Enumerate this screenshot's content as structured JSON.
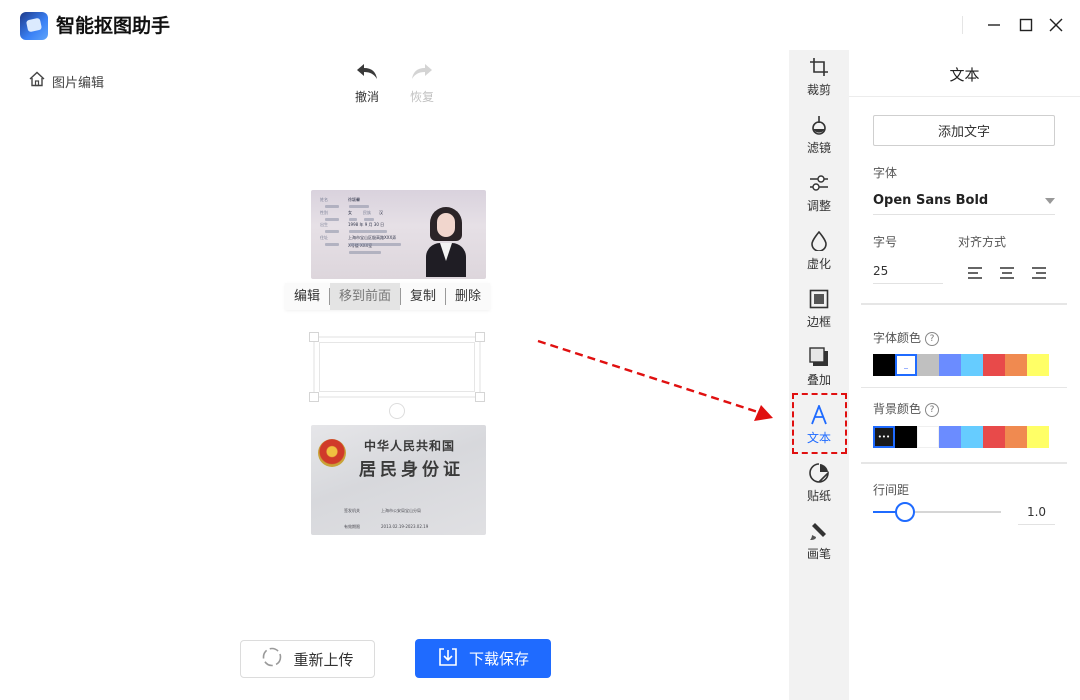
{
  "app": {
    "title": "智能抠图助手"
  },
  "breadcrumb": {
    "label": "图片编辑"
  },
  "history": {
    "undo_label": "撤消",
    "redo_label": "恢复"
  },
  "context_menu": {
    "items": [
      "编辑",
      "移到前面",
      "复制",
      "删除"
    ],
    "highlighted": "移到前面"
  },
  "id_back_text": {
    "country": "中华人民共和国",
    "card": "居民身份证",
    "issuer_label": "签发机关",
    "issuer_value": "上海市公安局宝山分局",
    "validity_label": "有效期限",
    "validity_value": "2013.02.19-2023.02.19"
  },
  "id_front_text": {
    "name_label": "姓名",
    "name_value": "徐颖馨",
    "sex_label": "性别",
    "sex_value": "女",
    "nation_label": "民族",
    "nation_value": "汉",
    "birth_label": "出生",
    "birth_value": "1998 年 9 月 30 日",
    "address_label": "住址",
    "address_line1": "上海市宝山区殷高路XXX弄",
    "address_line2": "X号楼 XXX室"
  },
  "bottom": {
    "reupload_label": "重新上传",
    "download_label": "下载保存"
  },
  "tools": [
    {
      "label": "裁剪",
      "icon": "crop-icon"
    },
    {
      "label": "滤镜",
      "icon": "filter-icon"
    },
    {
      "label": "调整",
      "icon": "adjust-icon"
    },
    {
      "label": "虚化",
      "icon": "blur-icon"
    },
    {
      "label": "边框",
      "icon": "border-icon"
    },
    {
      "label": "叠加",
      "icon": "overlay-icon"
    },
    {
      "label": "文本",
      "icon": "text-icon",
      "active": true
    },
    {
      "label": "贴纸",
      "icon": "sticker-icon"
    },
    {
      "label": "画笔",
      "icon": "brush-icon"
    }
  ],
  "panel": {
    "title": "文本",
    "add_text_label": "添加文字",
    "font_label": "字体",
    "font_value": "Open Sans Bold",
    "size_label": "字号",
    "size_value": "25",
    "align_label": "对齐方式",
    "font_color_label": "字体颜色",
    "font_colors": [
      "#000000",
      "#ffffff",
      "#c0c0c0",
      "#6b8cff",
      "#66ccff",
      "#e84a4a",
      "#f08a50",
      "#ffff66"
    ],
    "font_color_selected": 1,
    "bg_color_label": "背景颜色",
    "bg_colors": [
      "#1a1a1a",
      "#000000",
      "#ffffff",
      "#6b8cff",
      "#66ccff",
      "#e84a4a",
      "#f08a50",
      "#ffff66"
    ],
    "bg_color_selected": 0,
    "help_glyph": "?",
    "line_spacing_label": "行间距",
    "line_spacing_value": "1.0",
    "line_spacing_fraction": 0.25
  },
  "colors": {
    "accent": "#1f6bff",
    "highlight_red": "#e01010"
  }
}
